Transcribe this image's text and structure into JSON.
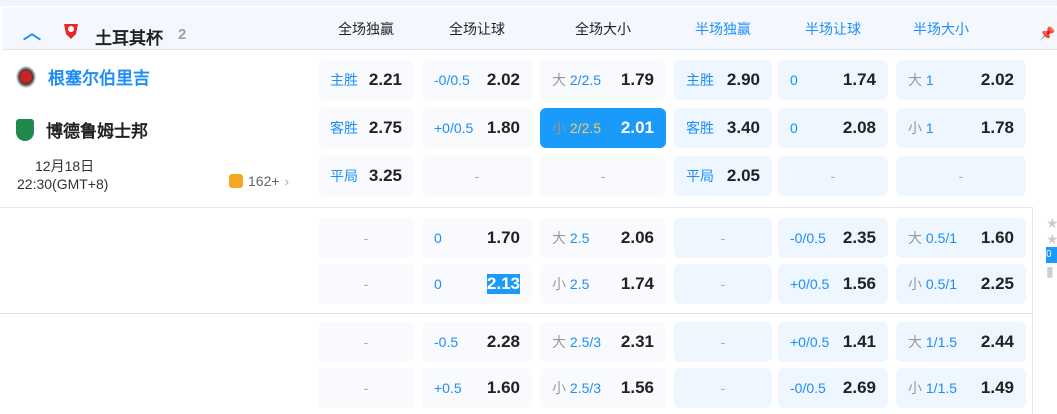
{
  "header": {
    "league": "土耳其杯",
    "count": "2",
    "columns": [
      "全场独赢",
      "全场让球",
      "全场大小",
      "半场独赢",
      "半场让球",
      "半场大小"
    ],
    "column_colors": [
      "#222222",
      "#222222",
      "#222222",
      "#1e8ef5",
      "#1e8ef5",
      "#1e8ef5"
    ]
  },
  "match": {
    "home": "根塞尔伯里吉",
    "away": "博德鲁姆士邦",
    "date": "12月18日",
    "time": "22:30(GMT+8)",
    "more": "162+"
  },
  "rows": [
    [
      {
        "p": "主胜",
        "o": "2.21"
      },
      {
        "l": "-0/0.5",
        "o": "2.02"
      },
      {
        "p": "大",
        "l": "2/2.5",
        "o": "1.79"
      },
      {
        "p": "主胜",
        "o": "2.90"
      },
      {
        "l": "0",
        "o": "1.74"
      },
      {
        "p": "大",
        "l": "1",
        "o": "2.02"
      }
    ],
    [
      {
        "p": "客胜",
        "o": "2.75"
      },
      {
        "l": "+0/0.5",
        "o": "1.80"
      },
      {
        "p": "小",
        "l": "2/2.5",
        "o": "2.01",
        "selected": true
      },
      {
        "p": "客胜",
        "o": "3.40"
      },
      {
        "l": "0",
        "o": "2.08"
      },
      {
        "p": "小",
        "l": "1",
        "o": "1.78"
      }
    ],
    [
      {
        "p": "平局",
        "o": "3.25"
      },
      {
        "d": "-"
      },
      {
        "d": "-"
      },
      {
        "p": "平局",
        "o": "2.05"
      },
      {
        "d": "-"
      },
      {
        "d": "-"
      }
    ],
    [
      {
        "d": "-"
      },
      {
        "l": "0",
        "o": "1.70"
      },
      {
        "p": "大",
        "l": "2.5",
        "o": "2.06"
      },
      {
        "d": "-"
      },
      {
        "l": "-0/0.5",
        "o": "2.35"
      },
      {
        "p": "大",
        "l": "0.5/1",
        "o": "1.60"
      }
    ],
    [
      {
        "d": "-"
      },
      {
        "l": "0",
        "o": "2.13",
        "highlight": true
      },
      {
        "p": "小",
        "l": "2.5",
        "o": "1.74"
      },
      {
        "d": "-"
      },
      {
        "l": "+0/0.5",
        "o": "1.56"
      },
      {
        "p": "小",
        "l": "0.5/1",
        "o": "2.25"
      }
    ],
    [
      {
        "d": "-"
      },
      {
        "l": "-0.5",
        "o": "2.28"
      },
      {
        "p": "大",
        "l": "2.5/3",
        "o": "2.31"
      },
      {
        "d": "-"
      },
      {
        "l": "+0/0.5",
        "o": "1.41"
      },
      {
        "p": "大",
        "l": "1/1.5",
        "o": "2.44"
      }
    ],
    [
      {
        "d": "-"
      },
      {
        "l": "+0.5",
        "o": "1.60"
      },
      {
        "p": "小",
        "l": "2.5/3",
        "o": "1.56"
      },
      {
        "d": "-"
      },
      {
        "l": "-0/0.5",
        "o": "2.69"
      },
      {
        "p": "小",
        "l": "1/1.5",
        "o": "1.49"
      }
    ]
  ]
}
